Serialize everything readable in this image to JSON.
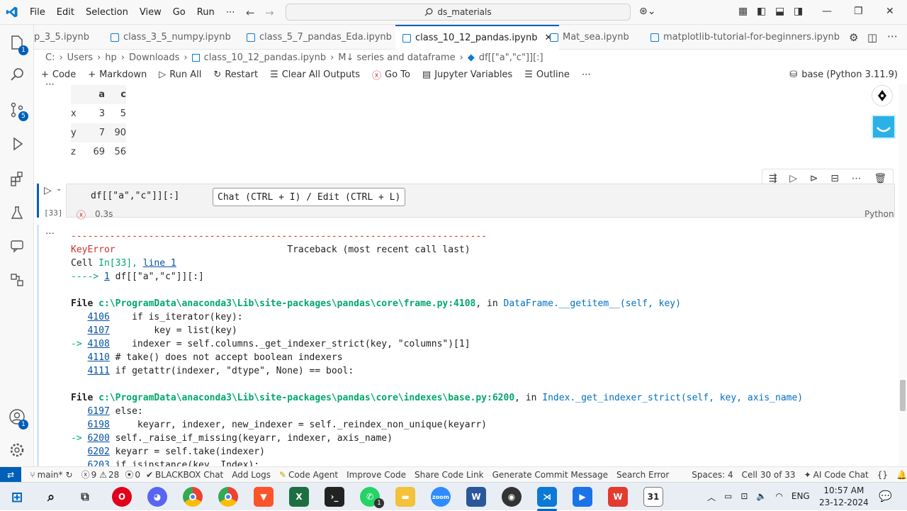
{
  "titlebar": {
    "menus": [
      "File",
      "Edit",
      "Selection",
      "View",
      "Go",
      "Run",
      "⋯"
    ],
    "search": "ds_materials"
  },
  "activity": {
    "explorer_badge": "1",
    "scm_badge": "5",
    "account_badge": "1"
  },
  "tabs": [
    {
      "label": "p_3_5.ipynb"
    },
    {
      "label": "class_3_5_numpy.ipynb"
    },
    {
      "label": "class_5_7_pandas_Eda.ipynb"
    },
    {
      "label": "class_10_12_pandas.ipynb",
      "active": true
    },
    {
      "label": "Mat_sea.ipynb"
    },
    {
      "label": "matplotlib-tutorial-for-beginners.ipynb"
    }
  ],
  "breadcrumb": [
    "C:",
    "Users",
    "hp",
    "Downloads",
    "class_10_12_pandas.ipynb",
    "M↓ series and dataframe",
    "df[[\"a\",\"c\"]][:]"
  ],
  "toolbar": {
    "code": "Code",
    "markdown": "Markdown",
    "run_all": "Run All",
    "restart": "Restart",
    "clear": "Clear All Outputs",
    "goto": "Go To",
    "variables": "Jupyter Variables",
    "outline": "Outline",
    "more": "⋯",
    "kernel": "base (Python 3.11.9)"
  },
  "dataframe": {
    "cols": [
      "a",
      "c"
    ],
    "rows": [
      {
        "idx": "x",
        "a": "3",
        "c": "5"
      },
      {
        "idx": "y",
        "a": "7",
        "c": "90"
      },
      {
        "idx": "z",
        "a": "69",
        "c": "56"
      }
    ]
  },
  "cell": {
    "code": "df[[\"a\",\"c\"]][:]",
    "exec_count": "[33]",
    "duration": "0.3s",
    "language": "Python",
    "chat_hint": "Chat (CTRL + I) / Edit (CTRL + L)",
    "collapse": "…"
  },
  "traceback": {
    "dashes": "---------------------------------------------------------------------------",
    "error": "KeyError",
    "header": "Traceback (most recent call last)",
    "cell_prefix": "Cell ",
    "cell_in": "In[33],",
    "cell_line": "line 1",
    "arrow_line_prefix": "----> ",
    "arrow_line_num": "1",
    "arrow_line_code": " df[[\"a\",\"c\"]][:]",
    "file1_prefix": "File ",
    "file1_path": "c:\\ProgramData\\anaconda3\\Lib\\site-packages\\pandas\\core\\frame.py:4108",
    "file1_in": ", in ",
    "file1_func": "DataFrame.__getitem__(self, key)",
    "f1": [
      {
        "mark": "   ",
        "num": "4106",
        "code": "    if is_iterator(key):"
      },
      {
        "mark": "   ",
        "num": "4107",
        "code": "        key = list(key)"
      },
      {
        "mark": "-> ",
        "num": "4108",
        "code": "    indexer = self.columns._get_indexer_strict(key, \"columns\")[1]"
      },
      {
        "mark": "   ",
        "num": "4110",
        "code": " # take() does not accept boolean indexers"
      },
      {
        "mark": "   ",
        "num": "4111",
        "code": " if getattr(indexer, \"dtype\", None) == bool:"
      }
    ],
    "file2_prefix": "File ",
    "file2_path": "c:\\ProgramData\\anaconda3\\Lib\\site-packages\\pandas\\core\\indexes\\base.py:6200",
    "file2_in": ", in ",
    "file2_func": "Index._get_indexer_strict(self, key, axis_name)",
    "f2": [
      {
        "mark": "   ",
        "num": "6197",
        "code": " else:"
      },
      {
        "mark": "   ",
        "num": "6198",
        "code": "     keyarr, indexer, new_indexer = self._reindex_non_unique(keyarr)"
      },
      {
        "mark": "-> ",
        "num": "6200",
        "code": " self._raise_if_missing(keyarr, indexer, axis_name)"
      },
      {
        "mark": "   ",
        "num": "6202",
        "code": " keyarr = self.take(indexer)"
      },
      {
        "mark": "   ",
        "num": "6203",
        "code": " if isinstance(key, Index):"
      }
    ]
  },
  "statusbar": {
    "branch": "main*",
    "errors": "9",
    "warnings": "28",
    "info": "0",
    "items": [
      "BLACKBOX Chat",
      "Add Logs",
      "Code Agent",
      "Improve Code",
      "Share Code Link",
      "Generate Commit Message",
      "Search Error"
    ],
    "spaces": "Spaces: 4",
    "cell": "Cell 30 of 33",
    "ai": "AI Code Chat"
  },
  "taskbar": {
    "lang": "ENG",
    "time": "10:57 AM",
    "date": "23-12-2024",
    "whatsapp_badge": "1",
    "calendar_day": "31"
  },
  "colors": {
    "accent": "#005fb8",
    "error": "#cd3131",
    "link": "#0451a5"
  }
}
